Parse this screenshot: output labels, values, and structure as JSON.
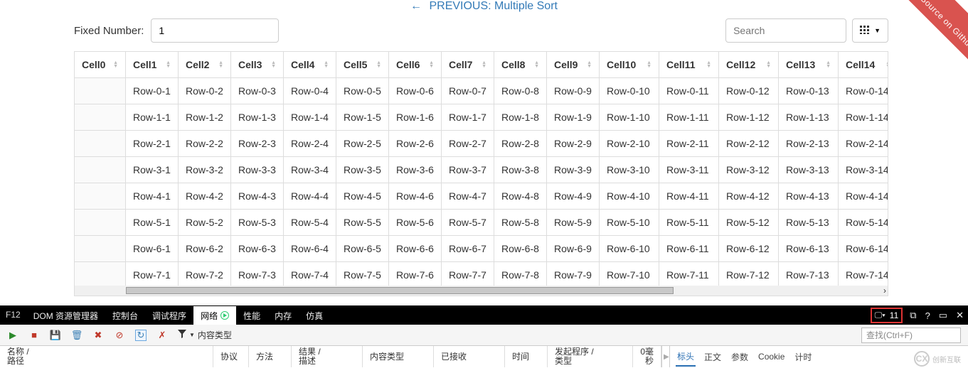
{
  "prev_link": {
    "arrow": "←",
    "text": "PREVIOUS: Multiple Sort"
  },
  "ribbon": "View Source on Github",
  "toolbar": {
    "fixed_label": "Fixed Number:",
    "fixed_value": "1",
    "search_placeholder": "Search"
  },
  "table": {
    "headers": [
      "Cell0",
      "Cell1",
      "Cell2",
      "Cell3",
      "Cell4",
      "Cell5",
      "Cell6",
      "Cell7",
      "Cell8",
      "Cell9",
      "Cell10",
      "Cell11",
      "Cell12",
      "Cell13",
      "Cell14"
    ],
    "rows": [
      [
        "",
        "Row-0-1",
        "Row-0-2",
        "Row-0-3",
        "Row-0-4",
        "Row-0-5",
        "Row-0-6",
        "Row-0-7",
        "Row-0-8",
        "Row-0-9",
        "Row-0-10",
        "Row-0-11",
        "Row-0-12",
        "Row-0-13",
        "Row-0-14"
      ],
      [
        "",
        "Row-1-1",
        "Row-1-2",
        "Row-1-3",
        "Row-1-4",
        "Row-1-5",
        "Row-1-6",
        "Row-1-7",
        "Row-1-8",
        "Row-1-9",
        "Row-1-10",
        "Row-1-11",
        "Row-1-12",
        "Row-1-13",
        "Row-1-14"
      ],
      [
        "",
        "Row-2-1",
        "Row-2-2",
        "Row-2-3",
        "Row-2-4",
        "Row-2-5",
        "Row-2-6",
        "Row-2-7",
        "Row-2-8",
        "Row-2-9",
        "Row-2-10",
        "Row-2-11",
        "Row-2-12",
        "Row-2-13",
        "Row-2-14"
      ],
      [
        "",
        "Row-3-1",
        "Row-3-2",
        "Row-3-3",
        "Row-3-4",
        "Row-3-5",
        "Row-3-6",
        "Row-3-7",
        "Row-3-8",
        "Row-3-9",
        "Row-3-10",
        "Row-3-11",
        "Row-3-12",
        "Row-3-13",
        "Row-3-14"
      ],
      [
        "",
        "Row-4-1",
        "Row-4-2",
        "Row-4-3",
        "Row-4-4",
        "Row-4-5",
        "Row-4-6",
        "Row-4-7",
        "Row-4-8",
        "Row-4-9",
        "Row-4-10",
        "Row-4-11",
        "Row-4-12",
        "Row-4-13",
        "Row-4-14"
      ],
      [
        "",
        "Row-5-1",
        "Row-5-2",
        "Row-5-3",
        "Row-5-4",
        "Row-5-5",
        "Row-5-6",
        "Row-5-7",
        "Row-5-8",
        "Row-5-9",
        "Row-5-10",
        "Row-5-11",
        "Row-5-12",
        "Row-5-13",
        "Row-5-14"
      ],
      [
        "",
        "Row-6-1",
        "Row-6-2",
        "Row-6-3",
        "Row-6-4",
        "Row-6-5",
        "Row-6-6",
        "Row-6-7",
        "Row-6-8",
        "Row-6-9",
        "Row-6-10",
        "Row-6-11",
        "Row-6-12",
        "Row-6-13",
        "Row-6-14"
      ],
      [
        "",
        "Row-7-1",
        "Row-7-2",
        "Row-7-3",
        "Row-7-4",
        "Row-7-5",
        "Row-7-6",
        "Row-7-7",
        "Row-7-8",
        "Row-7-9",
        "Row-7-10",
        "Row-7-11",
        "Row-7-12",
        "Row-7-13",
        "Row-7-14"
      ]
    ]
  },
  "devtools": {
    "f12": "F12",
    "tabs": [
      "DOM 资源管理器",
      "控制台",
      "调试程序",
      "网络",
      "性能",
      "内存",
      "仿真"
    ],
    "active_tab": "网络",
    "error_count": "11",
    "content_type": "内容类型",
    "find_placeholder": "查找(Ctrl+F)",
    "req_headers": {
      "name": "名称 /\n路径",
      "protocol": "协议",
      "method": "方法",
      "result": "结果 /\n描述",
      "ctype": "内容类型",
      "received": "已接收",
      "time": "时间",
      "initiator": "发起程序 /\n类型",
      "sum": "0毫秒"
    },
    "right_tabs": [
      "标头",
      "正文",
      "参数",
      "Cookie",
      "计时"
    ],
    "right_active": "标头"
  },
  "watermark": "创新互联"
}
